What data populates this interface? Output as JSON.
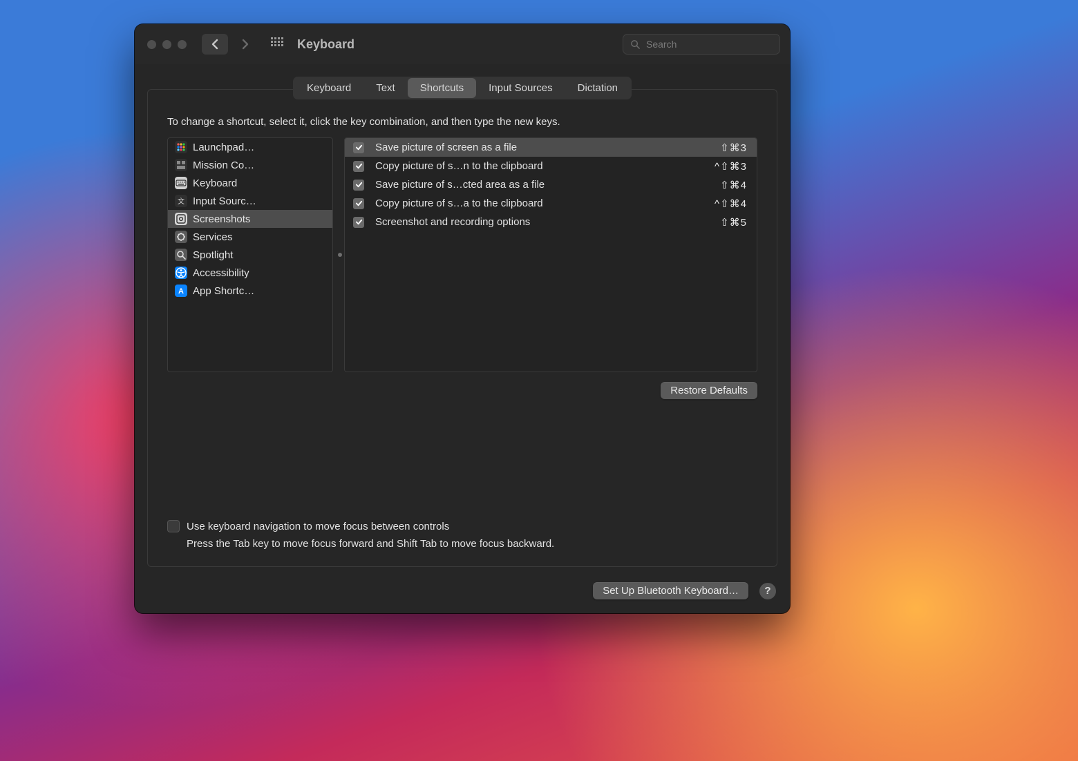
{
  "window": {
    "title": "Keyboard"
  },
  "search": {
    "placeholder": "Search"
  },
  "tabs": [
    {
      "label": "Keyboard",
      "active": false
    },
    {
      "label": "Text",
      "active": false
    },
    {
      "label": "Shortcuts",
      "active": true
    },
    {
      "label": "Input Sources",
      "active": false
    },
    {
      "label": "Dictation",
      "active": false
    }
  ],
  "instruction": "To change a shortcut, select it, click the key combination, and then type the new keys.",
  "categories": [
    {
      "label": "Launchpad…",
      "icon": "launchpad",
      "selected": false,
      "color": "#2f2f2f"
    },
    {
      "label": "Mission Co…",
      "icon": "mission-control",
      "selected": false,
      "color": "#2f2f2f"
    },
    {
      "label": "Keyboard",
      "icon": "keyboard",
      "selected": false,
      "color": "#d0d0d0"
    },
    {
      "label": "Input Sourc…",
      "icon": "input-sources",
      "selected": false,
      "color": "#2f2f2f"
    },
    {
      "label": "Screenshots",
      "icon": "screenshots",
      "selected": true,
      "color": "#d8d8d8"
    },
    {
      "label": "Services",
      "icon": "services",
      "selected": false,
      "color": "#5a5a5a"
    },
    {
      "label": "Spotlight",
      "icon": "spotlight",
      "selected": false,
      "color": "#5a5a5a"
    },
    {
      "label": "Accessibility",
      "icon": "accessibility",
      "selected": false,
      "color": "#0a84ff"
    },
    {
      "label": "App Shortc…",
      "icon": "app-shortcuts",
      "selected": false,
      "color": "#0a84ff"
    }
  ],
  "shortcuts": [
    {
      "checked": true,
      "label": "Save picture of screen as a file",
      "keys": "⇧⌘3",
      "selected": true
    },
    {
      "checked": true,
      "label": "Copy picture of s…n to the clipboard",
      "keys": "^⇧⌘3",
      "selected": false
    },
    {
      "checked": true,
      "label": "Save picture of s…cted area as a file",
      "keys": "⇧⌘4",
      "selected": false
    },
    {
      "checked": true,
      "label": "Copy picture of s…a to the clipboard",
      "keys": "^⇧⌘4",
      "selected": false
    },
    {
      "checked": true,
      "label": "Screenshot and recording options",
      "keys": "⇧⌘5",
      "selected": false
    }
  ],
  "buttons": {
    "restore": "Restore Defaults",
    "bluetooth": "Set Up Bluetooth Keyboard…"
  },
  "keyboardNav": {
    "checked": false,
    "label": "Use keyboard navigation to move focus between controls",
    "hint": "Press the Tab key to move focus forward and Shift Tab to move focus backward."
  },
  "help": "?"
}
